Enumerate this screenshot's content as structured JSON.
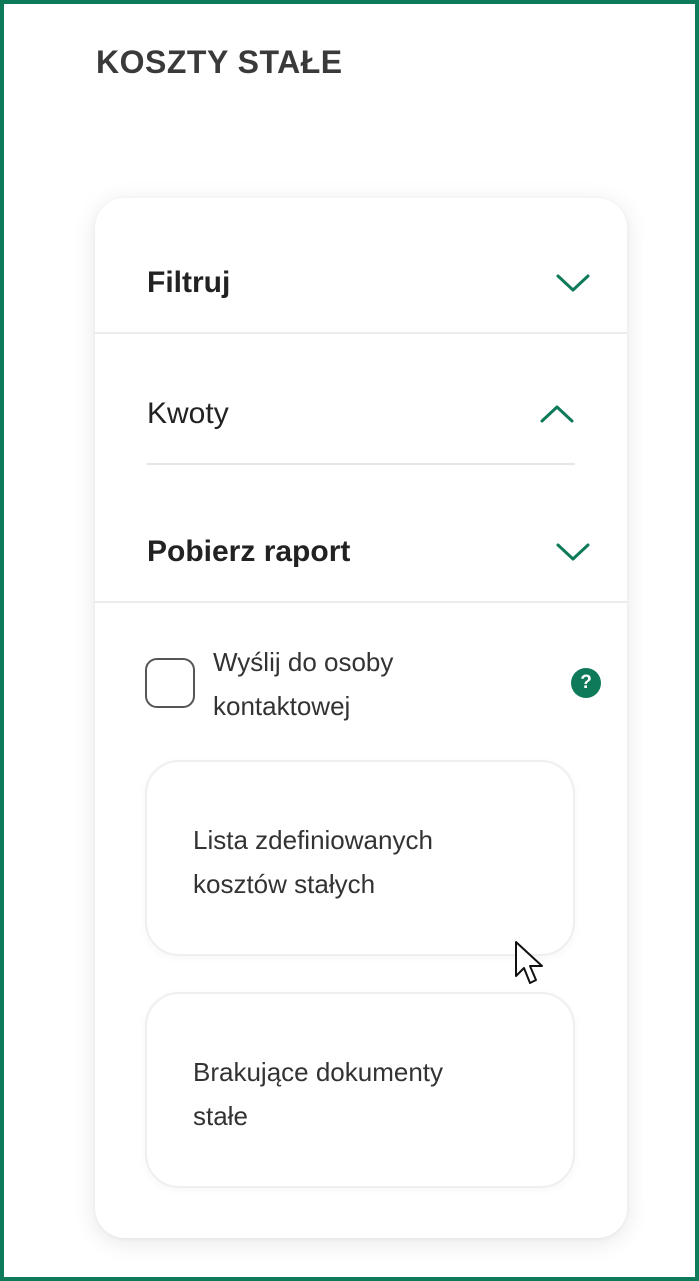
{
  "page": {
    "title": "KOSZTY STAŁE"
  },
  "sections": {
    "filtruj": {
      "label": "Filtruj",
      "state": "collapsed"
    },
    "kwoty": {
      "label": "Kwoty",
      "state": "expanded"
    },
    "pobierz": {
      "label": "Pobierz raport",
      "state": "collapsed"
    }
  },
  "contact": {
    "line1": "Wyślij do osoby",
    "line2": "kontaktowej",
    "checked": false,
    "help_symbol": "?"
  },
  "reports": [
    {
      "line1": "Lista zdefiniowanych",
      "line2": "kosztów stałych"
    },
    {
      "line1": "Brakujące dokumenty",
      "line2": "stałe"
    }
  ],
  "colors": {
    "accent": "#0f7a5a",
    "border": "#0f7a5a"
  },
  "icons": {
    "chevron_down": "chevron-down-icon",
    "chevron_up": "chevron-up-icon",
    "help": "question-circle-icon",
    "cursor": "mouse-pointer-icon"
  }
}
